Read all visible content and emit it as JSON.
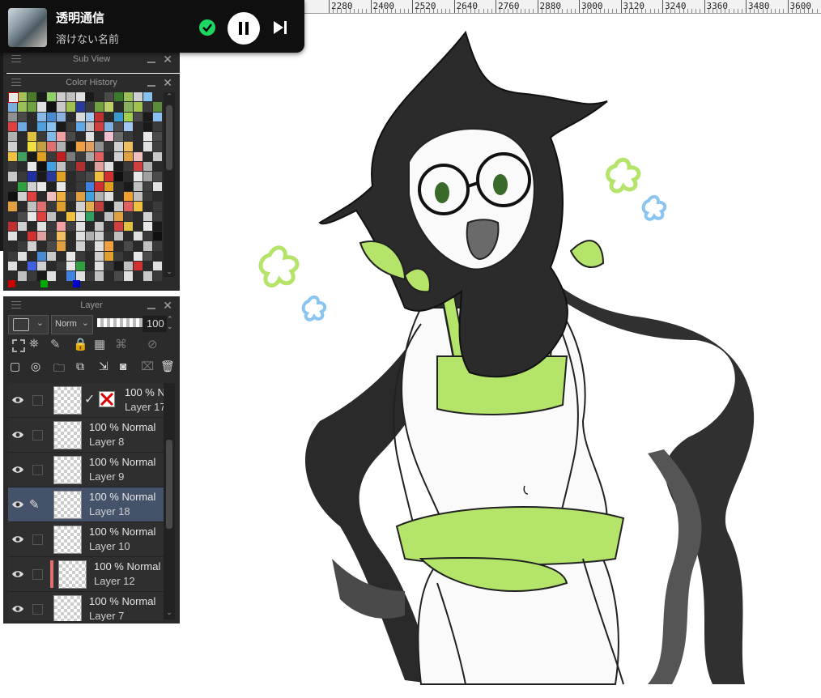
{
  "music": {
    "title": "透明通信",
    "artist": "溶けない名前"
  },
  "ruler": {
    "labels": [
      "2280",
      "2400",
      "2520",
      "2640",
      "2760",
      "2880",
      "3000",
      "3120",
      "3240",
      "3360",
      "3480",
      "3600"
    ]
  },
  "subview": {
    "title": "Sub View"
  },
  "color_history": {
    "title": "Color History",
    "main_color": "#cc0000",
    "sub_color": "#00aa00",
    "transparent_color": "#0000cc",
    "swatches": [
      "#e8e8e8",
      "#a3c25a",
      "#4a7a2a",
      "#1a1a1a",
      "#8fd06a",
      "#cccccc",
      "#c0c0c0",
      "#e0e0e0",
      "#1a1a1a",
      "#2a2a2a",
      "#4a4a4a",
      "#3a7a2a",
      "#9ac05a",
      "#d0d0d0",
      "#88c0f0",
      "#2a2a2a",
      "#7ab0e0",
      "#9ac05a",
      "#70a040",
      "#e0e0e0",
      "#101010",
      "#c8c8c8",
      "#a0c050",
      "#2a3a9a",
      "#3a3a3a",
      "#70a040",
      "#bcd06a",
      "#2a2a2a",
      "#88b060",
      "#a0c050",
      "#3a3a3a",
      "#5a8a3a",
      "#909090",
      "#4a4a4a",
      "#2a2a2a",
      "#88b8e8",
      "#4a8ad0",
      "#8ab0e0",
      "#2a2a2a",
      "#dadada",
      "#a0c8f0",
      "#c03030",
      "#2a2a2a",
      "#3a9ad0",
      "#a0d050",
      "#4a4a4a",
      "#1a1a1a",
      "#8ac0f0",
      "#e04040",
      "#70a8e0",
      "#2a2a2a",
      "#50a0e0",
      "#88c0f0",
      "#1a1a1a",
      "#3a3a3a",
      "#60a8e8",
      "#c0c0c0",
      "#d04040",
      "#80b0e0",
      "#4a4a4a",
      "#a0c8f0",
      "#2a2a2a",
      "#1a1a1a",
      "#3a3a3a",
      "#b0b0b0",
      "#2a2a2a",
      "#e0c040",
      "#3a3a3a",
      "#80b8e8",
      "#f0a0a0",
      "#4a4a4a",
      "#2a2a2a",
      "#e0e0e0",
      "#303030",
      "#f0c0d0",
      "#6a6a6a",
      "#3a3a3a",
      "#2a2a2a",
      "#e8e8e8",
      "#4a4a4a",
      "#d0d0d0",
      "#2a2a2a",
      "#f0e040",
      "#c0a040",
      "#e07070",
      "#b0b0b0",
      "#1a1a1a",
      "#f0a040",
      "#e0a060",
      "#909090",
      "#3a3a3a",
      "#d0d0d0",
      "#f0c060",
      "#2a2a2a",
      "#e0e0e0",
      "#404040",
      "#f0c040",
      "#40a060",
      "#1a1a1a",
      "#e0a020",
      "#3a3a3a",
      "#c02020",
      "#7a7a7a",
      "#3a3a3a",
      "#a8a8a8",
      "#e06060",
      "#2a2a2a",
      "#d0d0d0",
      "#e0a040",
      "#f0c0c0",
      "#2a2a2a",
      "#c8c8c8",
      "#3a3a3a",
      "#2a2a2a",
      "#e8e8e8",
      "#101010",
      "#40a0e0",
      "#c0c0c0",
      "#3a3a3a",
      "#b03030",
      "#2a2a2a",
      "#e0a0a0",
      "#e0e0e0",
      "#1a1a1a",
      "#3a3a3a",
      "#d04040",
      "#b0b0b0",
      "#2a2a2a",
      "#c8c8c8",
      "#3a3a3a",
      "#2030a0",
      "#1a1a1a",
      "#2a3a9a",
      "#e0a020",
      "#2a2a2a",
      "#3a3a3a",
      "#4a4a4a",
      "#f0c040",
      "#d03030",
      "#101010",
      "#2a2a2a",
      "#e8e8e8",
      "#a0a0a0",
      "#4a4a4a",
      "#2a2a2a",
      "#30a040",
      "#d0d0d0",
      "#e8e8e8",
      "#202020",
      "#e8e8e8",
      "#2a2a2a",
      "#3a3a3a",
      "#4080e0",
      "#d03030",
      "#e0a020",
      "#2a2a2a",
      "#1a1a1a",
      "#c0c0c0",
      "#404040",
      "#e0e0e0",
      "#101010",
      "#d0d0d0",
      "#e04040",
      "#2a2a2a",
      "#f0c0c0",
      "#f0b040",
      "#3a3a3a",
      "#e0a040",
      "#40a0e0",
      "#b0b0b0",
      "#e0e0e0",
      "#2a2a2a",
      "#f0a030",
      "#c0c0c0",
      "#3a3a3a",
      "#2a2a2a",
      "#e0a040",
      "#2a2a2a",
      "#c0c0c0",
      "#e07070",
      "#3a3a3a",
      "#e0a030",
      "#2a2a2a",
      "#d0d0d0",
      "#e0b050",
      "#c04040",
      "#1a1a1a",
      "#c8c8c8",
      "#e06060",
      "#f0c040",
      "#2a2a2a",
      "#3a3a3a",
      "#2a2a2a",
      "#4a4a4a",
      "#e8e8e8",
      "#e04040",
      "#c0c0c0",
      "#2a2a2a",
      "#f0c040",
      "#e0e0e0",
      "#30a060",
      "#2a2a2a",
      "#c0c0c0",
      "#e0a040",
      "#3a3a3a",
      "#2a2a2a",
      "#d0d0d0",
      "#3a3a3a",
      "#c03030",
      "#d0d0d0",
      "#2a2a2a",
      "#e0e0e0",
      "#3a3a3a",
      "#f0a0a0",
      "#404040",
      "#e0e0e0",
      "#2a2a2a",
      "#c8c8c8",
      "#303030",
      "#d04040",
      "#e0c040",
      "#2a2a2a",
      "#e8e8e8",
      "#1a1a1a",
      "#e0e0e0",
      "#2a2a2a",
      "#d03030",
      "#e0a0a0",
      "#3a3a3a",
      "#f0c060",
      "#2a2a2a",
      "#e0e0e0",
      "#b0b0b0",
      "#d0d0d0",
      "#3a3a3a",
      "#c0c0c0",
      "#2a2a2a",
      "#e0e0e0",
      "#3a3a3a",
      "#101010",
      "#2a2a2a",
      "#3a3a3a",
      "#d0d0d0",
      "#2a2a2a",
      "#4a4a4a",
      "#e0a040",
      "#2a2a2a",
      "#d0d0d0",
      "#3a3a3a",
      "#e0e0e0",
      "#f0a040",
      "#2a2a2a",
      "#4a4a4a",
      "#2a2a2a",
      "#c0c0c0",
      "#3a3a3a",
      "#3a3a3a",
      "#e0e0e0",
      "#2a2a2a",
      "#4a8ad0",
      "#c8c8c8",
      "#2a2a2a",
      "#e8e8e8",
      "#3a3a3a",
      "#2a2a2a",
      "#d0d0d0",
      "#e0a030",
      "#3a3a3a",
      "#2a2a2a",
      "#e8e8e8",
      "#4a4a4a",
      "#2a2a2a",
      "#e0e0e0",
      "#2a2a2a",
      "#4060e0",
      "#d0d0d0",
      "#2a2a2a",
      "#3a3a3a",
      "#e8e8e8",
      "#30a040",
      "#2a2a2a",
      "#e0e0e0",
      "#3a3a3a",
      "#1a1a1a",
      "#c0c0c0",
      "#d03030",
      "#2a2a2a",
      "#e0e0e0",
      "#2a2a2a",
      "#c0c0c0",
      "#3a3a3a",
      "#1a1a1a",
      "#e0e0e0",
      "#2a2a2a",
      "#4080e0",
      "#e0e0e0",
      "#3a3a3a",
      "#c0c0c0",
      "#2a2a2a",
      "#4a4a4a",
      "#e0e0e0",
      "#2a2a2a",
      "#c8c8c8",
      "#3a3a3a"
    ]
  },
  "layer_panel": {
    "title": "Layer",
    "blend_mode": "Norm",
    "opacity": "100",
    "layers": [
      {
        "mode": "100 % N",
        "name": "Layer 17",
        "has_mask": true,
        "selected": false,
        "editing": false,
        "color_label": null
      },
      {
        "mode": "100 % Normal",
        "name": "Layer 8",
        "has_mask": false,
        "selected": false,
        "editing": false,
        "color_label": null
      },
      {
        "mode": "100 % Normal",
        "name": "Layer 9",
        "has_mask": false,
        "selected": false,
        "editing": false,
        "color_label": null
      },
      {
        "mode": "100 % Normal",
        "name": "Layer 18",
        "has_mask": false,
        "selected": true,
        "editing": true,
        "color_label": null
      },
      {
        "mode": "100 % Normal",
        "name": "Layer 10",
        "has_mask": false,
        "selected": false,
        "editing": false,
        "color_label": null
      },
      {
        "mode": "100 % Normal",
        "name": "Layer 12",
        "has_mask": false,
        "selected": false,
        "editing": false,
        "color_label": "#e07070"
      },
      {
        "mode": "100 % Normal",
        "name": "Layer 7",
        "has_mask": false,
        "selected": false,
        "editing": false,
        "color_label": null
      }
    ]
  }
}
